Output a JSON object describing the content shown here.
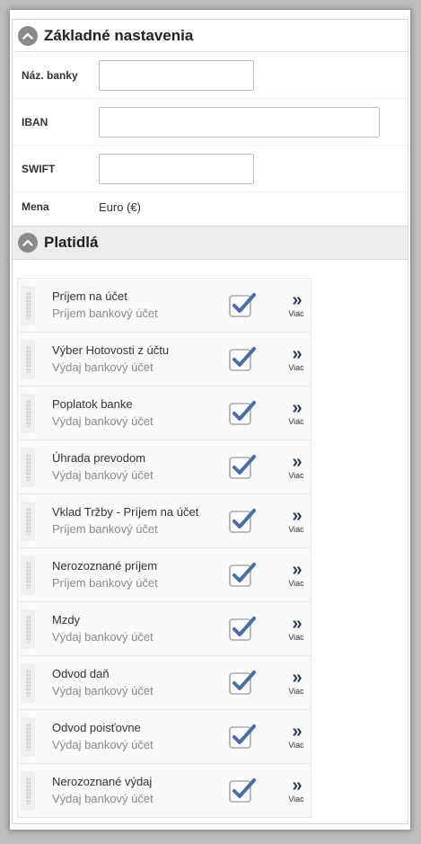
{
  "basic": {
    "title": "Základné nastavenia",
    "fields": {
      "bank_name": {
        "label": "Náz. banky",
        "value": ""
      },
      "iban": {
        "label": "IBAN",
        "value": ""
      },
      "swift": {
        "label": "SWIFT",
        "value": ""
      },
      "currency": {
        "label": "Mena",
        "value": "Euro (€)"
      }
    }
  },
  "payments": {
    "title": "Platidlá",
    "more_label": "Viac",
    "more_icon": "double-chevron-right-icon",
    "check_color": "#4a6fa5",
    "items": [
      {
        "title": "Príjem na účet",
        "subtitle": "Príjem bankový účet",
        "checked": true
      },
      {
        "title": "Výber Hotovosti z účtu",
        "subtitle": "Výdaj bankový účet",
        "checked": true
      },
      {
        "title": "Poplatok banke",
        "subtitle": "Výdaj bankový účet",
        "checked": true
      },
      {
        "title": "Úhrada prevodom",
        "subtitle": "Výdaj bankový účet",
        "checked": true
      },
      {
        "title": "Vklad Tržby - Príjem na účet",
        "subtitle": "Príjem bankový účet",
        "checked": true
      },
      {
        "title": "Nerozoznané príjem",
        "subtitle": "Príjem bankový účet",
        "checked": true
      },
      {
        "title": "Mzdy",
        "subtitle": "Výdaj bankový účet",
        "checked": true
      },
      {
        "title": "Odvod daň",
        "subtitle": "Výdaj bankový účet",
        "checked": true
      },
      {
        "title": "Odvod poisťovne",
        "subtitle": "Výdaj bankový účet",
        "checked": true
      },
      {
        "title": "Nerozoznané výdaj",
        "subtitle": "Výdaj bankový účet",
        "checked": true
      }
    ]
  }
}
